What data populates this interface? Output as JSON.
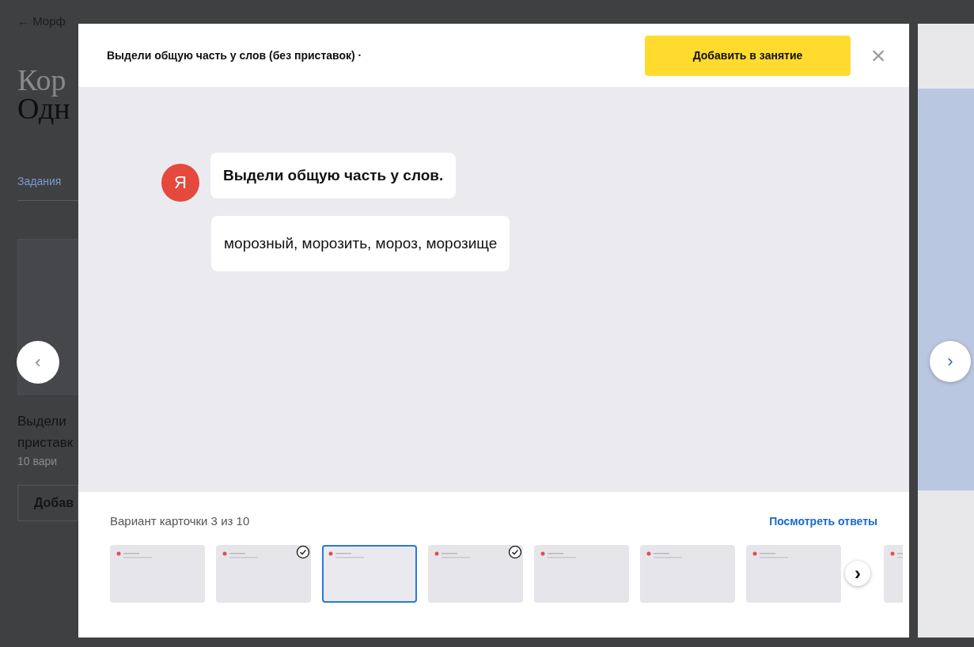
{
  "background_page": {
    "breadcrumb": "← Морф",
    "title_line_1": "Кор",
    "title_line_2": "Одн",
    "tab": "Задания",
    "card_text_line_1": "Выдели",
    "card_text_line_2": "приставк",
    "card_meta": "10 вари",
    "card_button": "Добав",
    "prev_button": "‹"
  },
  "modal": {
    "title": "Выдели общую часть у слов (без приставок) ·",
    "add_button": "Добавить в занятие",
    "close": "×",
    "avatar_letter": "Я",
    "messages": [
      "Выдели общую часть у слов.",
      "морозный, морозить, мороз, морозище"
    ],
    "variant_label": "Вариант карточки 3 из 10",
    "answers_link": "Посмотреть ответы",
    "thumbnails": [
      {
        "selected": false,
        "checked": false
      },
      {
        "selected": false,
        "checked": true
      },
      {
        "selected": true,
        "checked": false
      },
      {
        "selected": false,
        "checked": true
      },
      {
        "selected": false,
        "checked": false
      },
      {
        "selected": false,
        "checked": false
      },
      {
        "selected": false,
        "checked": false
      },
      {
        "selected": false,
        "checked": false
      }
    ],
    "strip_next": "›"
  },
  "next_card_button": "›"
}
